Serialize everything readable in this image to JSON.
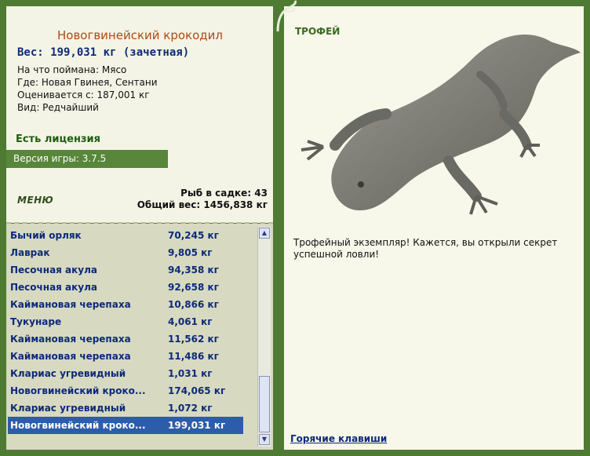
{
  "fish": {
    "name": "Новогвинейский крокодил",
    "weight_line": "Вес: 199,031 кг (зачетная)",
    "caught_on": "На что поймана: Мясо",
    "location": "Где: Новая Гвинея, Сентани",
    "valued_from": "Оценивается с: 187,001 кг",
    "kind": "Вид: Редчайший"
  },
  "license": "Есть лицензия",
  "version": "Версия игры: 3.7.5",
  "menu": "МЕНЮ",
  "stats": {
    "in_net": "Рыб в садке: 43",
    "total_weight": "Общий вес: 1456,838 кг"
  },
  "catches": [
    {
      "name": "Бычий орляк",
      "weight": "70,245 кг"
    },
    {
      "name": "Лаврак",
      "weight": "9,805 кг"
    },
    {
      "name": "Песочная акула",
      "weight": "94,358 кг"
    },
    {
      "name": "Песочная акула",
      "weight": "92,658 кг"
    },
    {
      "name": "Каймановая черепаха",
      "weight": "10,866 кг"
    },
    {
      "name": "Тукунаре",
      "weight": "4,061 кг"
    },
    {
      "name": "Каймановая черепаха",
      "weight": "11,562 кг"
    },
    {
      "name": "Каймановая черепаха",
      "weight": "11,486 кг"
    },
    {
      "name": "Клариас угревидный",
      "weight": "1,031 кг"
    },
    {
      "name": "Новогвинейский кроко...",
      "weight": "174,065 кг"
    },
    {
      "name": "Клариас угревидный",
      "weight": "1,072 кг"
    },
    {
      "name": "Новогвинейский кроко...",
      "weight": "199,031 кг"
    }
  ],
  "trophy": {
    "label": "ТРОФЕЙ",
    "text": "Трофейный экземпляр! Кажется, вы открыли секрет успешной ловли!"
  },
  "hotkeys": "Горячие клавиши",
  "colors": {
    "frame": "#4f7a33",
    "selected_row": "#2d5da8",
    "fish_name": "#b04a10"
  }
}
